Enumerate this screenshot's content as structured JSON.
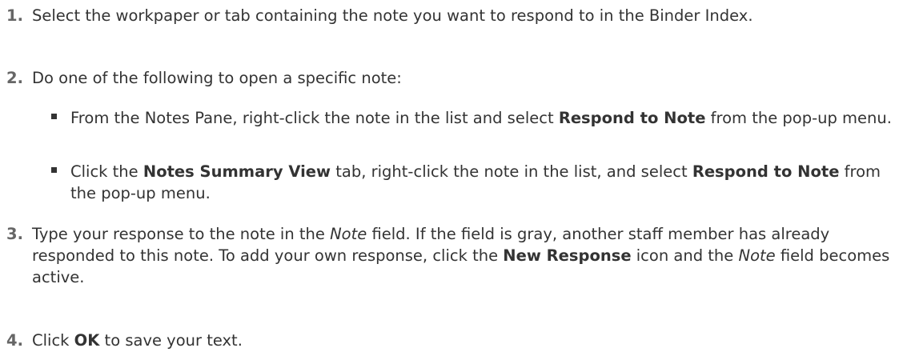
{
  "steps": [
    {
      "number": "1.",
      "segments": [
        {
          "text": "Select the workpaper or tab containing the note you want to respond to in the Binder Index.",
          "style": "normal"
        }
      ]
    },
    {
      "number": "2.",
      "segments": [
        {
          "text": "Do one of the following to open a specific note:",
          "style": "normal"
        }
      ],
      "bullets": [
        [
          {
            "text": "From the Notes Pane, right-click the note in the list and select ",
            "style": "normal"
          },
          {
            "text": "Respond to Note",
            "style": "bold"
          },
          {
            "text": " from the pop-up menu.",
            "style": "normal"
          }
        ],
        [
          {
            "text": "Click the ",
            "style": "normal"
          },
          {
            "text": "Notes Summary View",
            "style": "bold"
          },
          {
            "text": " tab, right-click the note in the list, and select ",
            "style": "normal"
          },
          {
            "text": "Respond to Note",
            "style": "bold"
          },
          {
            "text": " from the pop-up menu.",
            "style": "normal"
          }
        ]
      ]
    },
    {
      "number": "3.",
      "segments": [
        {
          "text": "Type your response to the note in the ",
          "style": "normal"
        },
        {
          "text": "Note",
          "style": "italic"
        },
        {
          "text": " field. If the field is gray, another staff member has already responded to this note. To add your own response, click the ",
          "style": "normal"
        },
        {
          "text": "New Response",
          "style": "bold"
        },
        {
          "text": " icon and the ",
          "style": "normal"
        },
        {
          "text": "Note",
          "style": "italic"
        },
        {
          "text": " field becomes active.",
          "style": "normal"
        }
      ]
    },
    {
      "number": "4.",
      "segments": [
        {
          "text": "Click ",
          "style": "normal"
        },
        {
          "text": "OK",
          "style": "bold"
        },
        {
          "text": " to save your text.",
          "style": "normal"
        }
      ]
    }
  ]
}
